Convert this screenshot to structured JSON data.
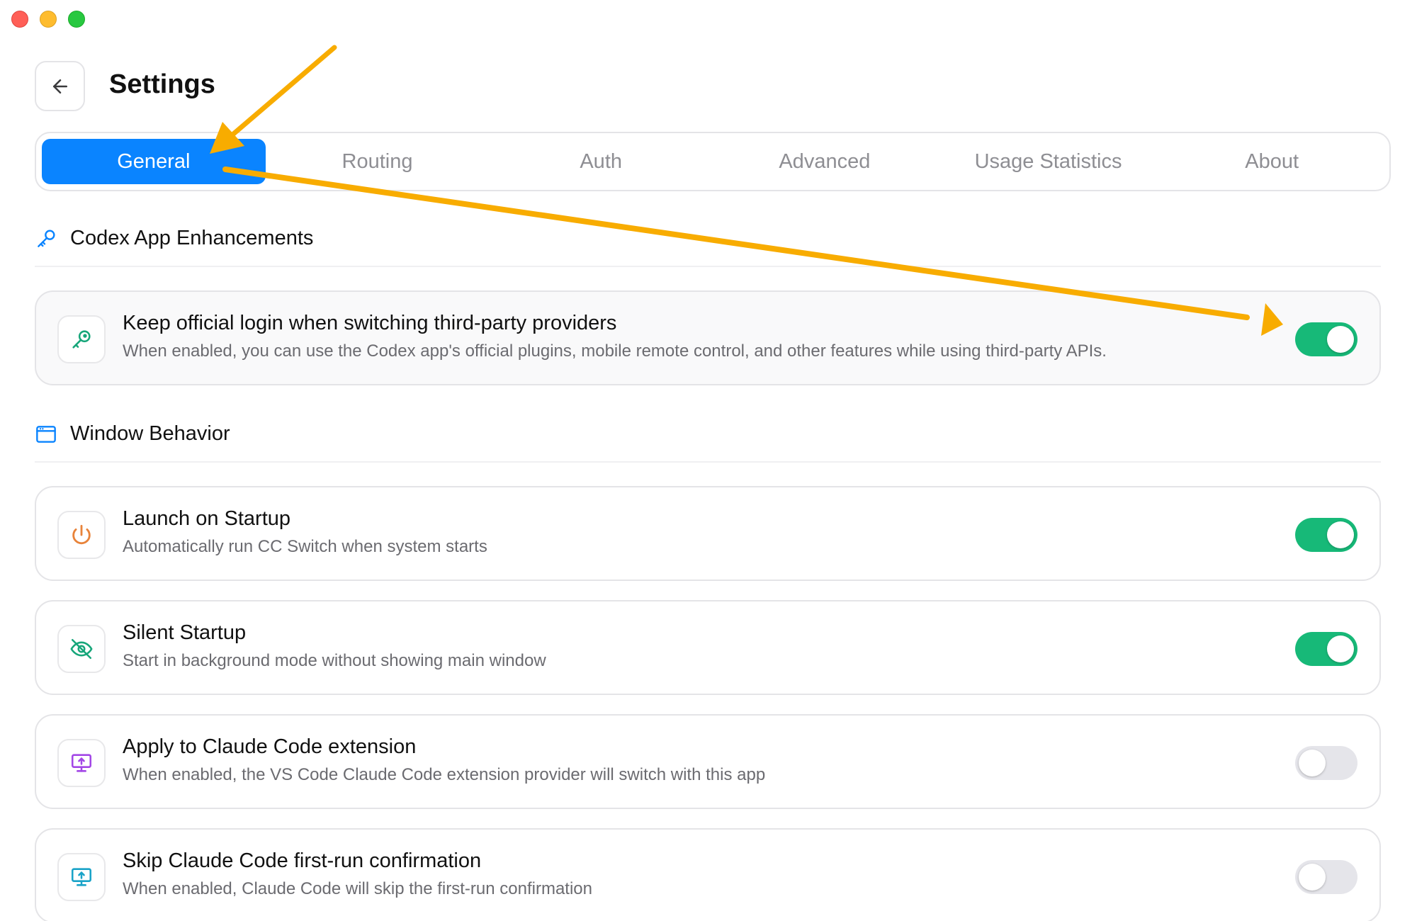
{
  "window": {
    "controls": [
      "close",
      "minimize",
      "zoom"
    ]
  },
  "header": {
    "back_icon": "arrow-left-icon",
    "title": "Settings"
  },
  "tabs": [
    {
      "label": "General",
      "active": true
    },
    {
      "label": "Routing",
      "active": false
    },
    {
      "label": "Auth",
      "active": false
    },
    {
      "label": "Advanced",
      "active": false
    },
    {
      "label": "Usage Statistics",
      "active": false
    },
    {
      "label": "About",
      "active": false
    }
  ],
  "sections": {
    "codex": {
      "title": "Codex App Enhancements",
      "icon": "key-icon",
      "items": [
        {
          "title": "Keep official login when switching third-party providers",
          "description": "When enabled, you can use the Codex app's official plugins, mobile remote control, and other features while using third-party APIs.",
          "icon": "key-icon",
          "enabled": true
        }
      ]
    },
    "window_behavior": {
      "title": "Window Behavior",
      "icon": "window-icon",
      "items": [
        {
          "title": "Launch on Startup",
          "description": "Automatically run CC Switch when system starts",
          "icon": "power-icon",
          "enabled": true
        },
        {
          "title": "Silent Startup",
          "description": "Start in background mode without showing main window",
          "icon": "eye-off-icon",
          "enabled": true
        },
        {
          "title": "Apply to Claude Code extension",
          "description": "When enabled, the VS Code Claude Code extension provider will switch with this app",
          "icon": "monitor-upload-icon",
          "enabled": false
        },
        {
          "title": "Skip Claude Code first-run confirmation",
          "description": "When enabled, Claude Code will skip the first-run confirmation",
          "icon": "monitor-upload-icon",
          "enabled": false
        }
      ]
    }
  },
  "colors": {
    "accent": "#0a84ff",
    "toggle_on": "#17b978",
    "toggle_off": "#e5e5ea",
    "annotation": "#f8ac00",
    "power_icon": "#e8833a",
    "eye_icon": "#17a67a",
    "monitor_icon_purple": "#a347e6",
    "monitor_icon_cyan": "#1aa3c8"
  }
}
